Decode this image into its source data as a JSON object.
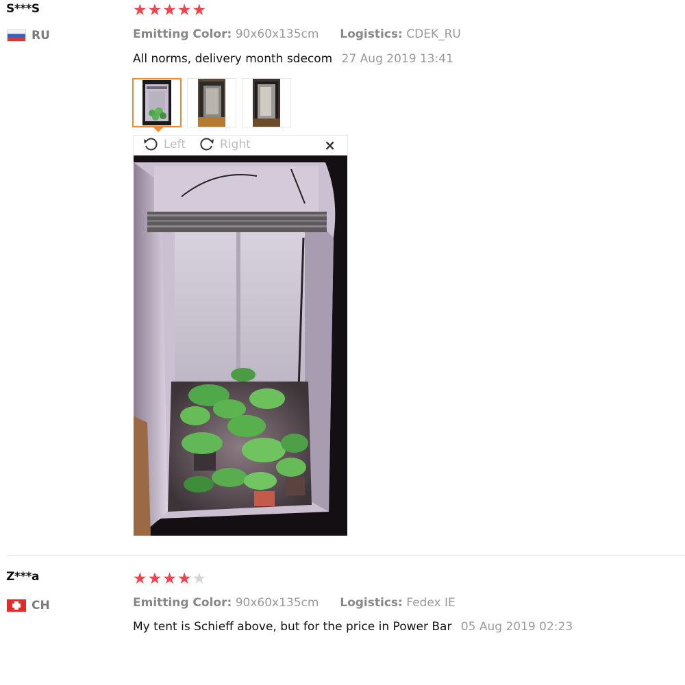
{
  "reviews": [
    {
      "user": "S***S",
      "country_code": "RU",
      "rating": 5,
      "stars": [
        "★",
        "★",
        "★",
        "★",
        "★"
      ],
      "emitting_color_label": "Emitting Color:",
      "emitting_color_value": "90x60x135cm",
      "logistics_label": "Logistics:",
      "logistics_value": "CDEK_RU",
      "comment": "All norms, delivery month sdecom",
      "date": "27 Aug 2019 13:41",
      "viewer": {
        "left_label": "Left",
        "right_label": "Right",
        "close_glyph": "×"
      }
    },
    {
      "user": "Z***a",
      "country_code": "CH",
      "rating": 4,
      "stars": [
        "★",
        "★",
        "★",
        "★",
        "★"
      ],
      "emitting_color_label": "Emitting Color:",
      "emitting_color_value": "90x60x135cm",
      "logistics_label": "Logistics:",
      "logistics_value": "Fedex IE",
      "comment": "My tent is Schieff above, but for the price in Power Bar",
      "date": "05 Aug 2019 02:23"
    }
  ],
  "colors": {
    "star_filled": "#f4424c",
    "star_empty": "#d6d6d6",
    "active_thumb": "#f18a2f"
  },
  "icons": [
    "rotate-left-icon",
    "rotate-right-icon",
    "close-icon",
    "flag-ru-icon",
    "flag-ch-icon"
  ]
}
